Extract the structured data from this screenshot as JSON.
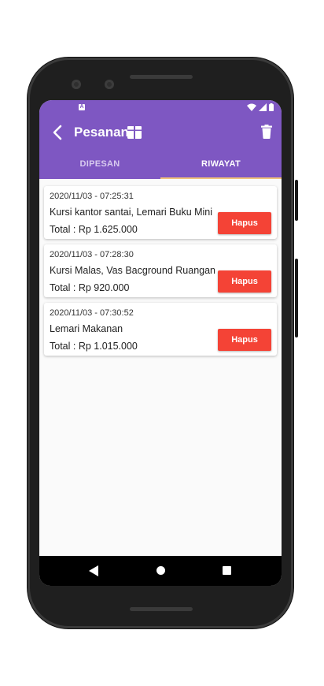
{
  "appbar": {
    "title": "Pesanan"
  },
  "tabs": [
    {
      "label": "DIPESAN",
      "active": false
    },
    {
      "label": "RIWAYAT",
      "active": true
    }
  ],
  "orders": [
    {
      "date": "2020/11/03 - 07:25:31",
      "items": "Kursi kantor santai, Lemari Buku Mini",
      "total": "Total : Rp 1.625.000",
      "button": "Hapus"
    },
    {
      "date": "2020/11/03 - 07:28:30",
      "items": "Kursi Malas, Vas Bacground Ruangan",
      "total": "Total : Rp 920.000",
      "button": "Hapus"
    },
    {
      "date": "2020/11/03 - 07:30:52",
      "items": "Lemari Makanan",
      "total": "Total : Rp 1.015.000",
      "button": "Hapus"
    }
  ],
  "status": {
    "notification_badge": "A"
  },
  "colors": {
    "primary": "#7e57c2",
    "accent": "#f1c27b",
    "danger": "#f44336"
  },
  "icons": [
    "back-arrow-icon",
    "box-icon",
    "trash-icon",
    "wifi-icon",
    "signal-icon",
    "battery-icon",
    "nav-back-icon",
    "nav-home-icon",
    "nav-recent-icon"
  ]
}
